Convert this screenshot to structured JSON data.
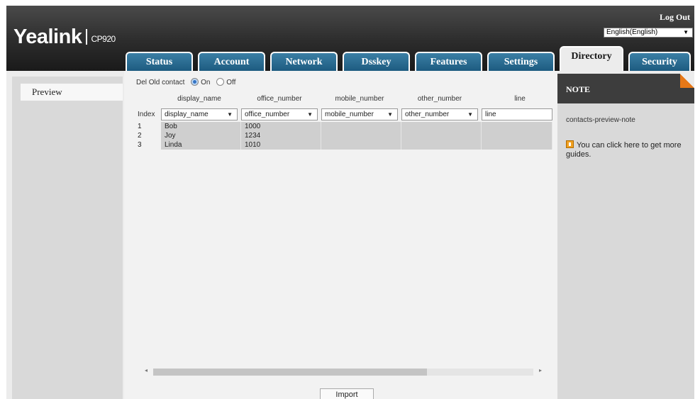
{
  "header": {
    "brand": "Yealink",
    "model": "CP920",
    "logout_label": "Log Out",
    "language": "English(English)"
  },
  "tabs": [
    {
      "label": "Status",
      "active": false
    },
    {
      "label": "Account",
      "active": false
    },
    {
      "label": "Network",
      "active": false
    },
    {
      "label": "Dsskey",
      "active": false
    },
    {
      "label": "Features",
      "active": false
    },
    {
      "label": "Settings",
      "active": false
    },
    {
      "label": "Directory",
      "active": true
    },
    {
      "label": "Security",
      "active": false
    }
  ],
  "sidebar": {
    "items": [
      {
        "label": "Preview",
        "selected": true
      }
    ]
  },
  "main": {
    "del_old_contact": {
      "label": "Del Old contact",
      "options": [
        "On",
        "Off"
      ],
      "selected": "On"
    },
    "index_label": "Index",
    "columns": [
      {
        "header": "display_name",
        "selected": "display_name"
      },
      {
        "header": "office_number",
        "selected": "office_number"
      },
      {
        "header": "mobile_number",
        "selected": "mobile_number"
      },
      {
        "header": "other_number",
        "selected": "other_number"
      },
      {
        "header": "line",
        "selected": "line"
      }
    ],
    "rows": [
      {
        "index": "1",
        "cells": [
          "Bob",
          "1000",
          "",
          "",
          ""
        ]
      },
      {
        "index": "2",
        "cells": [
          "Joy",
          "1234",
          "",
          "",
          ""
        ]
      },
      {
        "index": "3",
        "cells": [
          "Linda",
          "1010",
          "",
          "",
          ""
        ]
      }
    ],
    "import_label": "Import"
  },
  "note": {
    "title": "NOTE",
    "note_id": "contacts-preview-note",
    "guide_text": "You can click here to get more guides."
  },
  "colors": {
    "header_bg": "#2c2c2c",
    "tab_bg": "#1d5b80",
    "note_accent": "#e77817"
  }
}
